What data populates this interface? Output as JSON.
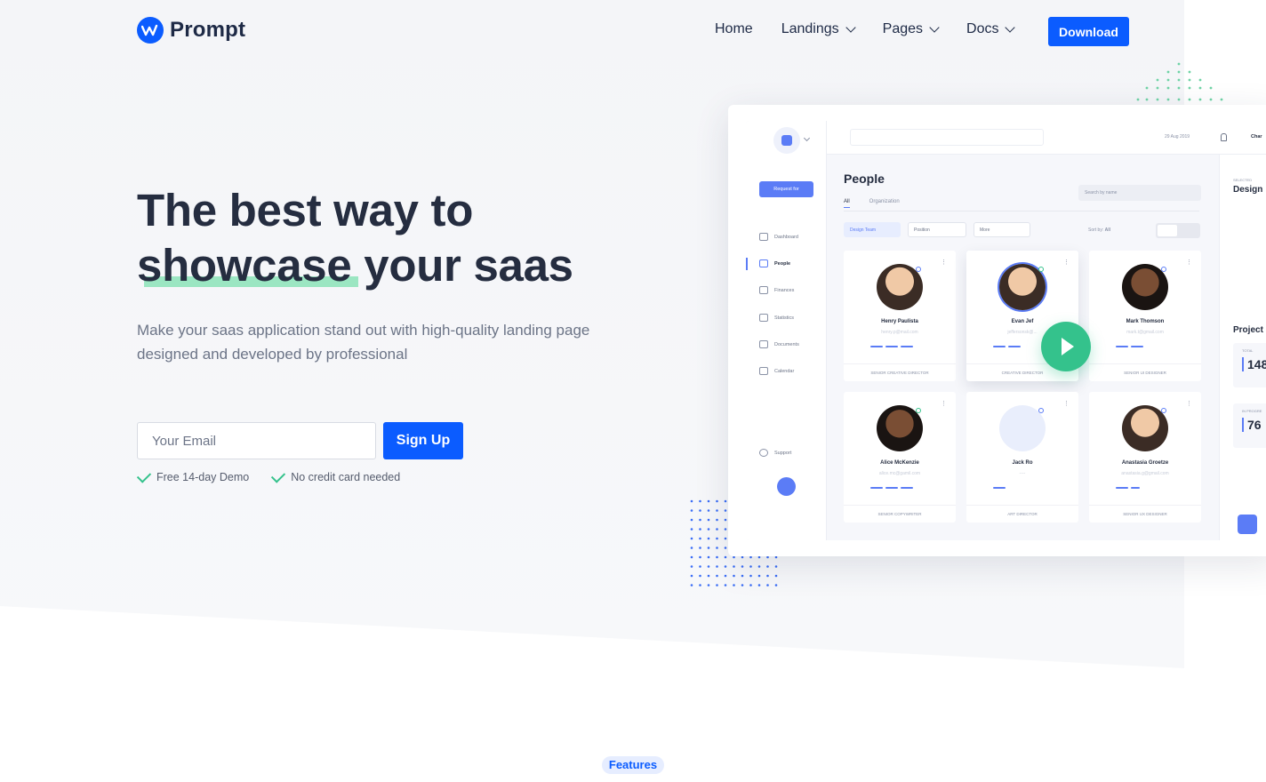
{
  "nav": {
    "logo": "Prompt",
    "items": [
      {
        "label": "Home",
        "has_dropdown": false
      },
      {
        "label": "Landings",
        "has_dropdown": true
      },
      {
        "label": "Pages",
        "has_dropdown": true
      },
      {
        "label": "Docs",
        "has_dropdown": true
      }
    ],
    "download": "Download"
  },
  "hero": {
    "title_line1": "The best way to",
    "title_highlight": "showcase",
    "title_rest": " your saas",
    "subtitle": "Make your saas application stand out with high-quality landing page designed and developed by professional",
    "email_placeholder": "Your Email",
    "signup": "Sign Up",
    "checks": [
      "Free 14-day Demo",
      "No credit card needed"
    ]
  },
  "dashboard": {
    "request_button": "Request for",
    "sidebar": [
      "Dashboard",
      "People",
      "Finances",
      "Statistics",
      "Documents",
      "Calendar"
    ],
    "support": "Support",
    "date": "29 Aug 2019",
    "user": "Char",
    "title": "People",
    "tabs": [
      "All",
      "Organization"
    ],
    "search_placeholder": "Search by name",
    "filters": [
      "Design Team",
      "Position",
      "More"
    ],
    "sort_label": "Sort by:",
    "sort_value": "All",
    "cards": [
      {
        "name": "Henry Paulista",
        "email": "henry.p@mail.com",
        "pct": "100%",
        "role": "SENIOR CREATIVE DIRECTOR"
      },
      {
        "name": "Evan Jef",
        "email": "jeffersonsk@...",
        "pct": "",
        "role": "CREATIVE DIRECTOR"
      },
      {
        "name": "Mark Thomson",
        "email": "mark.t@gmail.com",
        "pct": "66%",
        "role": "SENIOR UI DESIGNER"
      },
      {
        "name": "Alice McKenzie",
        "email": "alice.mc@gamil.com",
        "pct": "100%",
        "role": "SENIOR COPYWRITER"
      },
      {
        "name": "Jack Ro",
        "email": "----",
        "pct": "33%",
        "role": "ART DIRECTOR"
      },
      {
        "name": "Anastasia Groetze",
        "email": "anastasia.g@gmail.com",
        "pct": "48%",
        "role": "SENIOR UX DESIGNER"
      }
    ],
    "right_panel": {
      "selected": "SELECTED",
      "design": "Design",
      "projects": "Project",
      "total_label": "TOTAL",
      "total": "148",
      "progress_label": "IN PROGRE",
      "in_progress": "76"
    }
  },
  "features_badge": "Features",
  "colors": {
    "primary": "#0b5cff",
    "accent_green": "#34c28c",
    "highlight": "#9be6c2"
  }
}
